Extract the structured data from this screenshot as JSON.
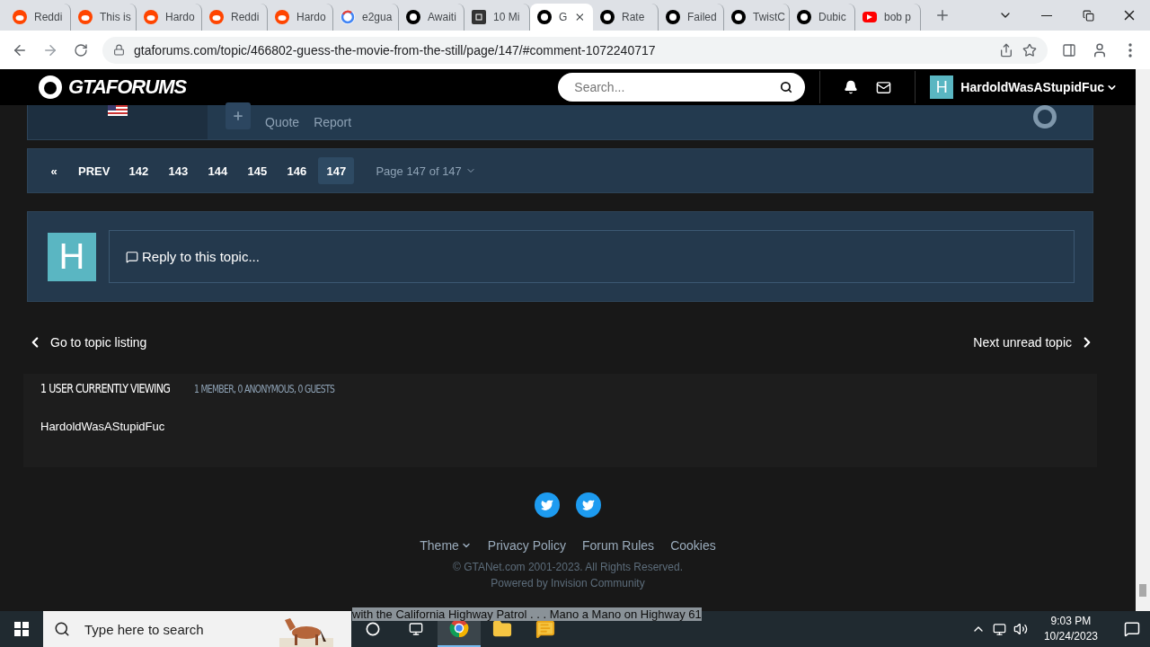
{
  "browser": {
    "tabs": [
      {
        "title": "Reddi",
        "kind": "reddit",
        "selected": false
      },
      {
        "title": "This is",
        "kind": "reddit",
        "selected": false
      },
      {
        "title": "Hardo",
        "kind": "reddit",
        "selected": false
      },
      {
        "title": "Reddi",
        "kind": "reddit",
        "selected": false
      },
      {
        "title": "Hardo",
        "kind": "reddit",
        "selected": false
      },
      {
        "title": "e2gua",
        "kind": "google",
        "selected": false
      },
      {
        "title": "Awaiti",
        "kind": "gta",
        "selected": false
      },
      {
        "title": "10 Mi",
        "kind": "ten",
        "selected": false
      },
      {
        "title": "G",
        "kind": "gta",
        "selected": true
      },
      {
        "title": "Rate",
        "kind": "gta",
        "selected": false
      },
      {
        "title": "Failed",
        "kind": "gta",
        "selected": false
      },
      {
        "title": "TwistC",
        "kind": "gta",
        "selected": false
      },
      {
        "title": "Dubic",
        "kind": "gta",
        "selected": false
      },
      {
        "title": "bob p",
        "kind": "youtube",
        "selected": false
      }
    ],
    "address": "gtaforums.com/topic/466802-guess-the-movie-from-the-still/page/147/#comment-1072240717"
  },
  "header": {
    "logo": "GTAFORUMS",
    "search": {
      "placeholder": "Search..."
    },
    "avatar_letter": "H",
    "username": "HardoldWasAStupidFuc"
  },
  "post_actions": [
    "Quote",
    "Report"
  ],
  "pagination": {
    "first": "«",
    "prev": "PREV",
    "pages": [
      {
        "label": "142",
        "selected": false
      },
      {
        "label": "143",
        "selected": false
      },
      {
        "label": "144",
        "selected": false
      },
      {
        "label": "145",
        "selected": false
      },
      {
        "label": "146",
        "selected": false
      },
      {
        "label": "147",
        "selected": true
      }
    ],
    "jump": "Page 147 of 147"
  },
  "reply": {
    "avatar_letter": "H",
    "placeholder": "Reply to this topic..."
  },
  "nav": {
    "back": "Go to topic listing",
    "next": "Next unread topic"
  },
  "viewing": {
    "title": "1 USER CURRENTLY VIEWING",
    "detail": "1 MEMBER, 0 ANONYMOUS, 0 GUESTS",
    "users": [
      "HardoldWasAStupidFuc"
    ]
  },
  "footer": {
    "links": [
      "Theme",
      "Privacy Policy",
      "Forum Rules",
      "Cookies"
    ],
    "copyright": "© GTANet.com 2001-2023. All Rights Reserved.",
    "powered": "Powered by Invision Community"
  },
  "taskbar": {
    "search": {
      "placeholder": "Type here to search"
    },
    "hover_text": "with the California Highway Patrol . . . Mano a Mano on Highway 61",
    "time": "9:03 PM",
    "date": "10/24/2023"
  }
}
